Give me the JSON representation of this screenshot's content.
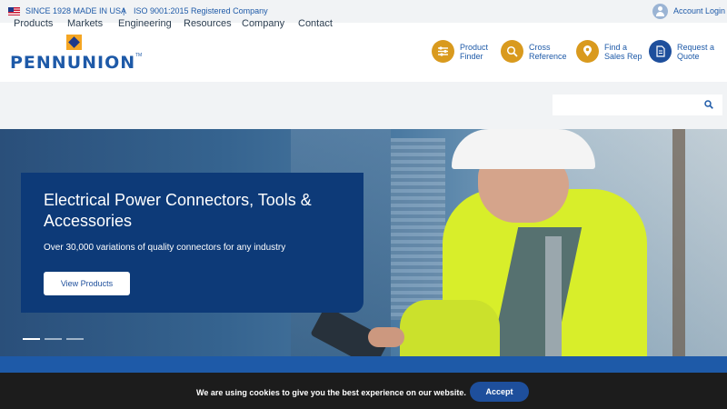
{
  "topbar": {
    "since": "SINCE 1928 MADE IN USA",
    "separator": "|",
    "iso": "ISO 9001:2015 Registered Company",
    "account": "Account Login"
  },
  "logo": {
    "text": "PENNUNION",
    "tm": "TM"
  },
  "header_nav": [
    {
      "line1": "Product",
      "line2": "Finder",
      "icon": "sliders-icon"
    },
    {
      "line1": "Cross",
      "line2": "Reference",
      "icon": "magnifier-icon"
    },
    {
      "line1": "Find a",
      "line2": "Sales Rep",
      "icon": "location-pin-icon"
    },
    {
      "line1": "Request a",
      "line2": "Quote",
      "icon": "document-icon"
    }
  ],
  "main_nav": [
    "Products",
    "Markets",
    "Engineering",
    "Resources",
    "Company",
    "Contact"
  ],
  "search": {
    "placeholder": ""
  },
  "hero": {
    "title": "Electrical Power Connectors, Tools & Accessories",
    "subtitle": "Over 30,000 variations of quality connectors for any industry",
    "button": "View Products",
    "active_slide": 1,
    "slide_count": 3
  },
  "cookie": {
    "text": "We are using cookies to give you the best experience on our website.",
    "button": "Accept"
  },
  "colors": {
    "brand_blue": "#1e5aa8",
    "navy": "#0d3a78",
    "gold": "#d99a1e",
    "cookie_bg": "#1c1c1c"
  }
}
